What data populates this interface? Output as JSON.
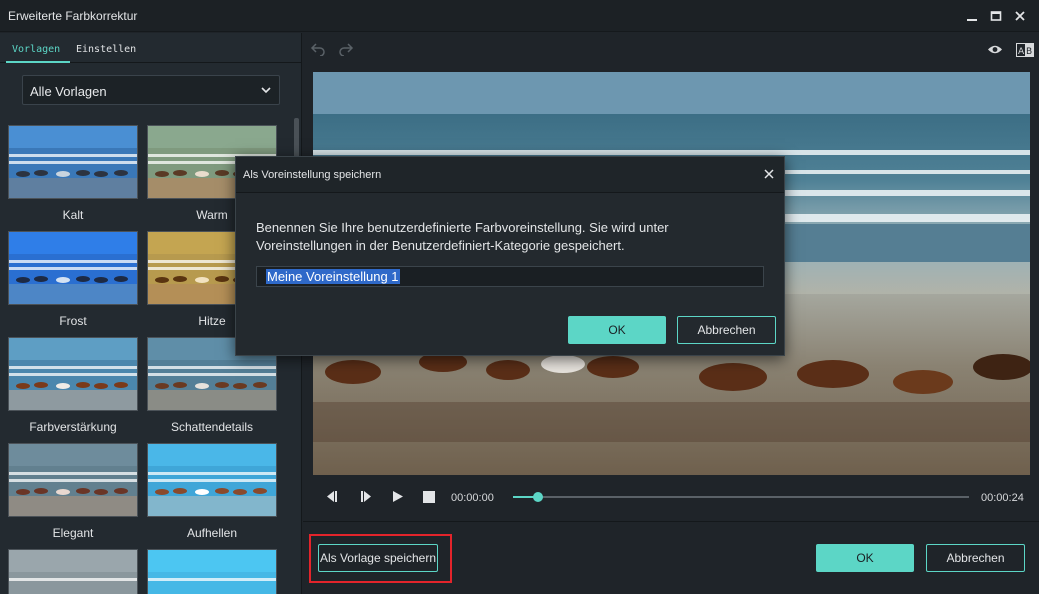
{
  "window": {
    "title": "Erweiterte Farbkorrektur"
  },
  "left_panel": {
    "tabs": [
      {
        "label": "Vorlagen",
        "active": true
      },
      {
        "label": "Einstellen",
        "active": false
      }
    ],
    "dropdown": {
      "selected": "Alle Vorlagen"
    },
    "presets": [
      {
        "label": "Kalt"
      },
      {
        "label": "Warm"
      },
      {
        "label": "Frost"
      },
      {
        "label": "Hitze"
      },
      {
        "label": "Farbverstärkung"
      },
      {
        "label": "Schattendetails"
      },
      {
        "label": "Elegant"
      },
      {
        "label": "Aufhellen"
      }
    ]
  },
  "player": {
    "current_time": "00:00:00",
    "total_time": "00:00:24",
    "progress": 0.055
  },
  "footer": {
    "save_template_label": "Als Vorlage speichern",
    "ok_label": "OK",
    "cancel_label": "Abbrechen"
  },
  "modal": {
    "title": "Als Voreinstellung speichern",
    "message": "Benennen Sie Ihre benutzerdefinierte Farbvoreinstellung. Sie wird unter Voreinstellungen in der Benutzerdefiniert-Kategorie gespeichert.",
    "input_value": "Meine Voreinstellung 1",
    "ok_label": "OK",
    "cancel_label": "Abbrechen"
  },
  "colors": {
    "accent": "#5cd6c6",
    "highlight": "#e3242b",
    "selection": "#2f69c9"
  }
}
